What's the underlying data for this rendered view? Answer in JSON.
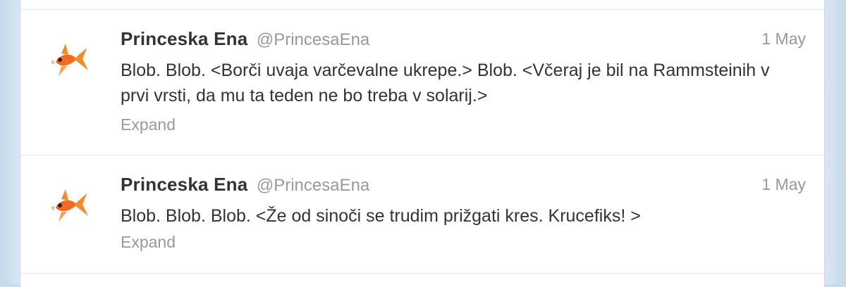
{
  "tweets": [
    {
      "name": "Princeska Ena",
      "handle": "@PrincesaEna",
      "time": "1 May",
      "text": "Blob. Blob. <Borči uvaja varčevalne ukrepe.> Blob. <Včeraj je bil na Rammsteinih v prvi vrsti, da mu ta teden ne bo treba v solarij.>",
      "expand_label": "Expand",
      "avatar_icon": "goldfish-icon"
    },
    {
      "name": "Princeska Ena",
      "handle": "@PrincesaEna",
      "time": "1 May",
      "text": "Blob. Blob. Blob. <Že od sinoči se trudim prižgati kres. Krucefiks! >",
      "expand_label": "Expand",
      "avatar_icon": "goldfish-icon"
    }
  ],
  "colors": {
    "name": "#333333",
    "meta": "#999999",
    "avatar_fish": "#f07020",
    "background": "#d7e6f2"
  }
}
